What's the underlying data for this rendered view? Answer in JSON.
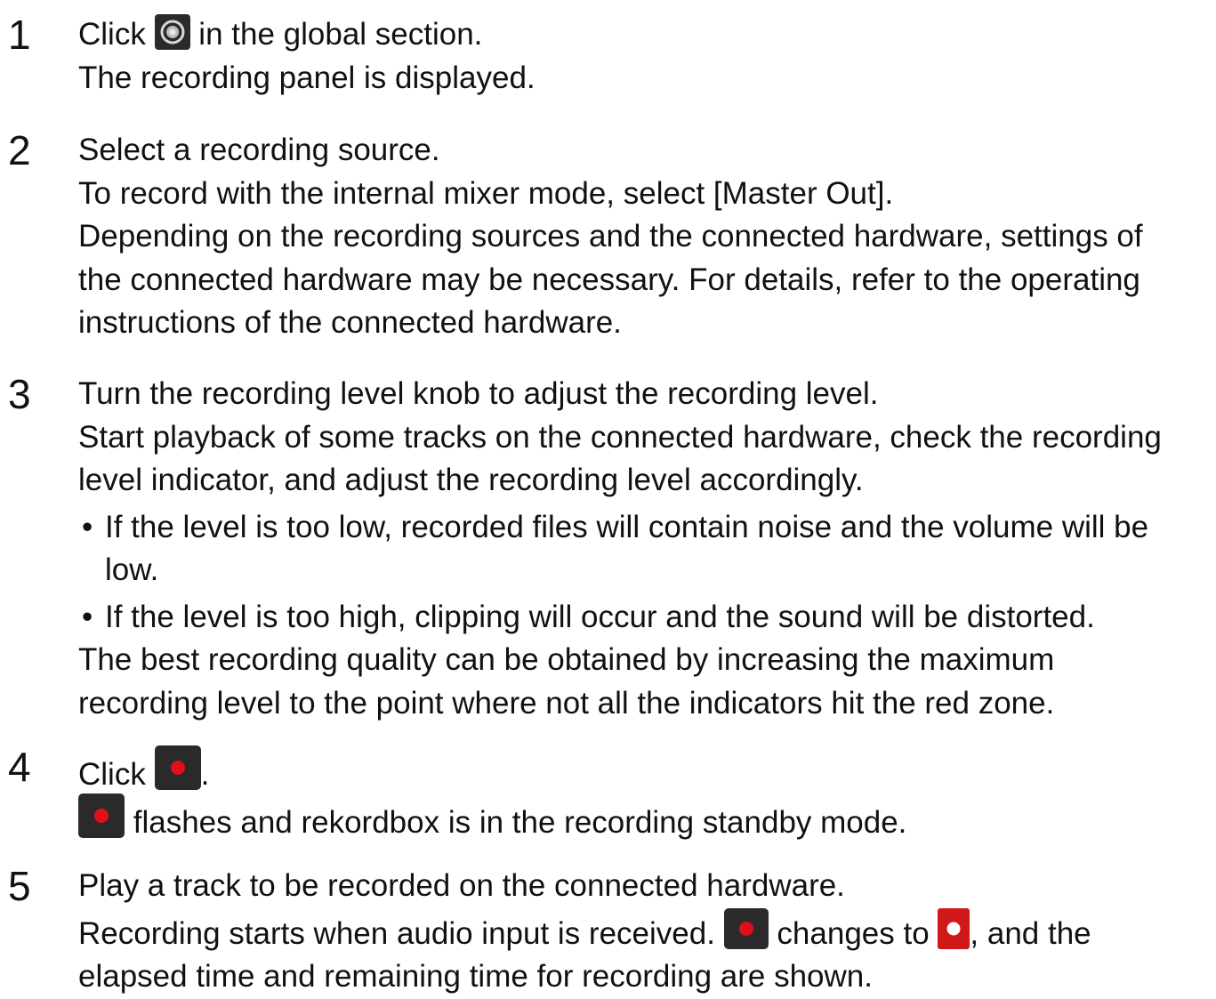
{
  "steps": [
    {
      "number": "1",
      "pre": "Click",
      "icon": "recording-panel-icon",
      "post": "in the global section.",
      "lines": [
        "The recording panel is displayed."
      ]
    },
    {
      "number": "2",
      "lines": [
        "Select a recording source.",
        "To record with the internal mixer mode, select [Master Out].",
        "Depending on the recording sources and the connected hardware, settings of",
        "the connected hardware may be necessary. For details, refer to the operating",
        "instructions of the connected hardware."
      ]
    },
    {
      "number": "3",
      "lines": [
        "Turn the recording level knob to adjust the recording level.",
        "Start playback of some tracks on the connected hardware, check the recording",
        "level indicator, and adjust the recording level accordingly."
      ],
      "bullets": [
        [
          "If the level is too low, recorded files will contain noise and the volume will be",
          "low."
        ],
        [
          "If the level is too high, clipping will occur and the sound will be distorted."
        ]
      ],
      "after": [
        "The best recording quality can be obtained by increasing the maximum",
        "recording level to the point where not all the indicators hit the red zone."
      ]
    },
    {
      "number": "4",
      "pre": "Click",
      "icon": "record-button-icon",
      "post": ".",
      "line2": "flashes and rekordbox is in the recording standby mode."
    },
    {
      "number": "5",
      "lines": [
        "Play a track to be recorded on the connected hardware."
      ],
      "line2_a": "Recording starts when audio input is received.",
      "line2_b": "changes to",
      "line2_c": ", and the",
      "line3": "elapsed time and remaining time for recording are shown."
    }
  ],
  "bullet_char": "•",
  "colors": {
    "text": "#111111",
    "icon_dark": "#2a2a2a",
    "record_red": "#e0101a",
    "recording_active_bg": "#d01818"
  }
}
